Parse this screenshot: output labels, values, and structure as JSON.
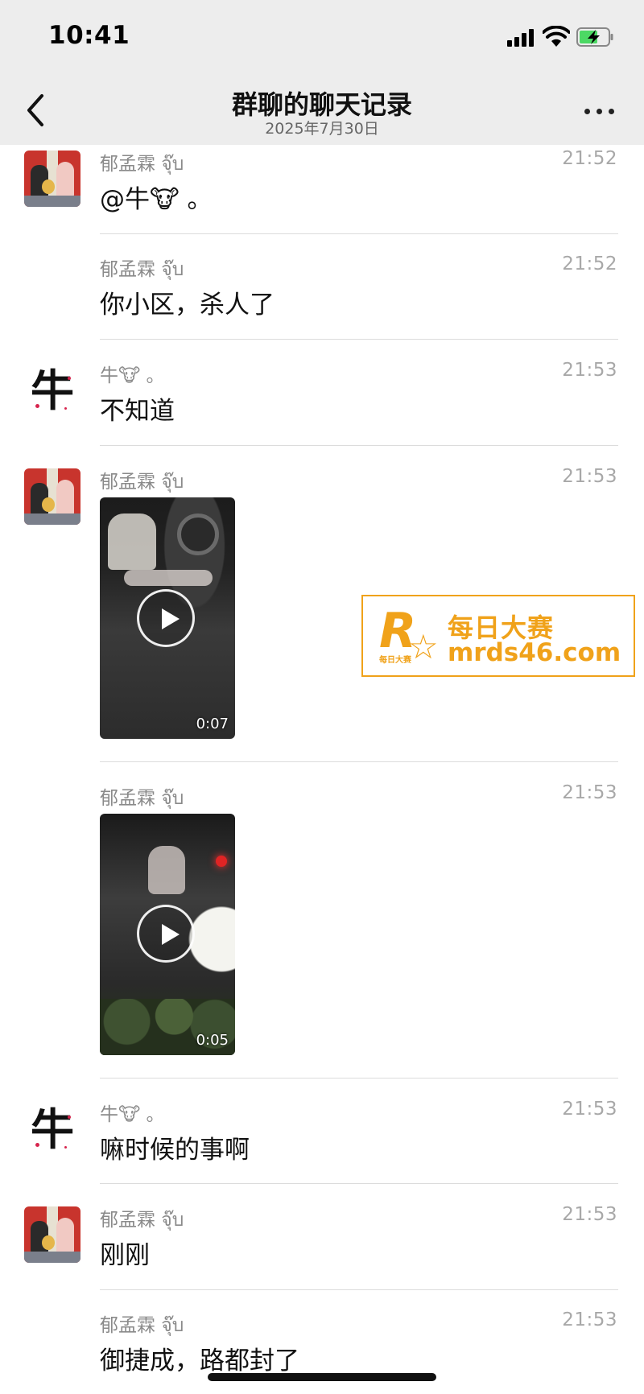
{
  "status_bar": {
    "time": "10:41"
  },
  "nav": {
    "title": "群聊的聊天记录",
    "subtitle": "2025年7月30日"
  },
  "messages": [
    {
      "sender": "郁孟霖 จุ๊บ",
      "time": "21:52",
      "text": "@牛🐮 。"
    },
    {
      "sender": "郁孟霖 จุ๊บ",
      "time": "21:52",
      "text": "你小区，杀人了"
    },
    {
      "sender": "牛🐮 。",
      "time": "21:53",
      "text": "不知道"
    },
    {
      "sender": "郁孟霖 จุ๊บ",
      "time": "21:53",
      "video_duration": "0:07"
    },
    {
      "sender": "郁孟霖 จุ๊บ",
      "time": "21:53",
      "video_duration": "0:05"
    },
    {
      "sender": "牛🐮 。",
      "time": "21:53",
      "text": "嘛时候的事啊"
    },
    {
      "sender": "郁孟霖 จุ๊บ",
      "time": "21:53",
      "text": "刚刚"
    },
    {
      "sender": "郁孟霖 จุ๊บ",
      "time": "21:53",
      "text": "御捷成，路都封了"
    }
  ],
  "avatars": {
    "ox_char": "牛"
  },
  "watermark": {
    "logo_letter": "R",
    "logo_small_text": "每日大赛",
    "name": "每日大赛",
    "url": "mrds46.com",
    "color": "#f0a21a"
  }
}
